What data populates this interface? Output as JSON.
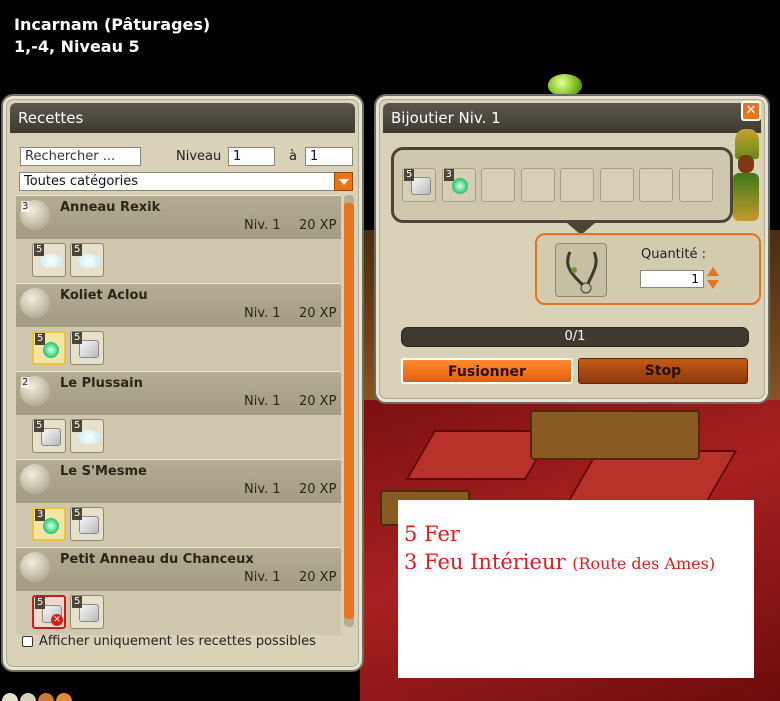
{
  "header": {
    "location": "Incarnam (Pâturages)",
    "coords": "1,-4, Niveau 5"
  },
  "recettes": {
    "title": "Recettes",
    "search_placeholder": "Rechercher ...",
    "niveau_label": "Niveau",
    "niveau_from": "1",
    "a_label": "à",
    "niveau_to": "1",
    "category": "Toutes catégories",
    "recipes": [
      {
        "name": "Anneau Rexik",
        "level": "Niv. 1",
        "xp": "20 XP",
        "icon_qty": "3",
        "ingredients": [
          {
            "qty": "5",
            "kind": "cloud"
          },
          {
            "qty": "5",
            "kind": "cloud"
          }
        ]
      },
      {
        "name": "Koliet Aclou",
        "level": "Niv. 1",
        "xp": "20 XP",
        "icon_qty": "",
        "ingredients": [
          {
            "qty": "5",
            "kind": "fire",
            "state": "highlight"
          },
          {
            "qty": "5",
            "kind": "iron"
          }
        ]
      },
      {
        "name": "Le Plussain",
        "level": "Niv. 1",
        "xp": "20 XP",
        "icon_qty": "2",
        "ingredients": [
          {
            "qty": "5",
            "kind": "iron"
          },
          {
            "qty": "5",
            "kind": "cloud"
          }
        ]
      },
      {
        "name": "Le S'Mesme",
        "level": "Niv. 1",
        "xp": "20 XP",
        "icon_qty": "",
        "ingredients": [
          {
            "qty": "3",
            "kind": "fire",
            "state": "highlight"
          },
          {
            "qty": "5",
            "kind": "iron"
          }
        ]
      },
      {
        "name": "Petit Anneau du Chanceux",
        "level": "Niv. 1",
        "xp": "20 XP",
        "icon_qty": "",
        "ingredients": [
          {
            "qty": "5",
            "kind": "iron",
            "state": "invalid"
          },
          {
            "qty": "5",
            "kind": "iron"
          }
        ]
      }
    ],
    "only_possible_label": "Afficher uniquement les recettes possibles"
  },
  "bijoutier": {
    "title": "Bijoutier Niv. 1",
    "close_label": "✕",
    "craft_slots": [
      {
        "qty": "5",
        "kind": "iron"
      },
      {
        "qty": "3",
        "kind": "fire"
      },
      {
        "qty": "",
        "kind": ""
      },
      {
        "qty": "",
        "kind": ""
      },
      {
        "qty": "",
        "kind": ""
      },
      {
        "qty": "",
        "kind": ""
      },
      {
        "qty": "",
        "kind": ""
      },
      {
        "qty": "",
        "kind": ""
      }
    ],
    "quantity_label": "Quantité :",
    "quantity_value": "1",
    "progress_text": "0/1",
    "progress_fraction": 0,
    "fuse_label": "Fusionner",
    "stop_label": "Stop"
  },
  "note": {
    "line1": "5 Fer",
    "line2": "3 Feu Intérieur",
    "line2_small": "(Route des Ames)"
  },
  "colors": {
    "accent": "#e8731c",
    "note_text": "#d42020",
    "window_bg": "#d9d2b8",
    "title_bar": "#3e3a30"
  }
}
